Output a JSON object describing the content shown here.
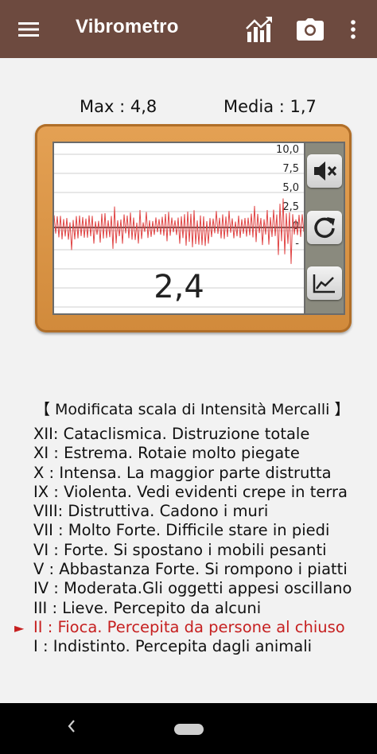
{
  "app": {
    "title": "Vibrometro"
  },
  "stats": {
    "max": "Max : 4,8",
    "media": "Media : 1,7"
  },
  "meter": {
    "reading": "2,4",
    "axis_labels": [
      "10,0",
      "7,5",
      "5,0",
      "2,5",
      "0",
      "-"
    ]
  },
  "buttons": {
    "mute": "speaker-mute-icon",
    "reset": "refresh-icon",
    "chart": "chart-icon"
  },
  "scale": {
    "title": "【 Modificata scala di Intensità Mercalli 】",
    "active_index": 10,
    "items": [
      "XII: Cataclismica. Distruzione totale",
      "XI : Estrema. Rotaie molto piegate",
      "X  : Intensa. La maggior parte distrutta",
      "IX : Violenta. Vedi evidenti crepe in terra",
      "VIII: Distruttiva. Cadono i muri",
      "VII : Molto Forte. Difficile stare in piedi",
      "VI : Forte. Si spostano i mobili pesanti",
      "V  : Abbastanza Forte. Si rompono i piatti",
      "IV : Moderata.Gli oggetti appesi oscillano",
      "III : Lieve. Percepito da alcuni",
      "II : Fioca. Percepita da persone al chiuso",
      "I  : Indistinto. Percepita dagli animali"
    ]
  },
  "colors": {
    "appbar": "#6d4a3f",
    "frame": "#d9913f",
    "active": "#c62020",
    "signal": "#e04545"
  }
}
